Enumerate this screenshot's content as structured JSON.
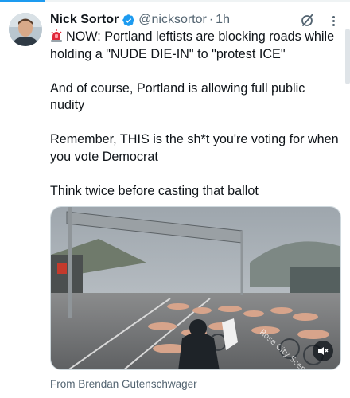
{
  "tweet": {
    "author_name": "Nick Sortor",
    "handle": "@nicksortor",
    "separator": "·",
    "timestamp": "1h",
    "verified_badge_icon": "verified-badge-icon",
    "lines": [
      "NOW: Portland leftists are blocking roads while holding a \"NUDE DIE-IN\" to \"protest ICE\"",
      "And of course, Portland is allowing full public nudity",
      "Remember, THIS is the sh*t you're voting for when you vote Democrat",
      "Think twice before casting that ballot"
    ],
    "siren_icon": "police-siren-emoji",
    "media": {
      "kind": "video",
      "watermark": "Rose City Scene",
      "mute_icon": "speaker-muted-icon"
    },
    "source_attribution": "From Brendan Gutenschwager"
  },
  "colors": {
    "text_primary": "#0f1419",
    "text_secondary": "#536471",
    "verified_blue": "#1d9bf0",
    "border": "#cfd9de"
  }
}
